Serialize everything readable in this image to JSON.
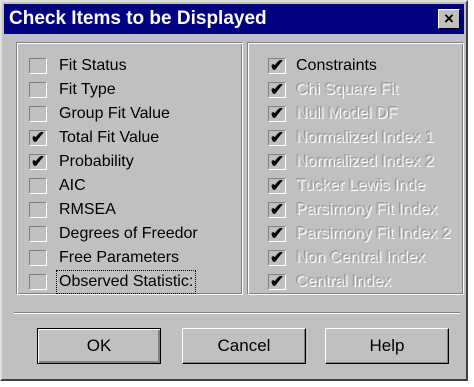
{
  "dialog": {
    "title": "Check Items to be Displayed",
    "close_label": "×"
  },
  "left_items": [
    {
      "label": "Fit Status",
      "checked": false,
      "disabled": false
    },
    {
      "label": "Fit Type",
      "checked": false,
      "disabled": false
    },
    {
      "label": "Group Fit Value",
      "checked": false,
      "disabled": false
    },
    {
      "label": "Total Fit Value",
      "checked": true,
      "disabled": false
    },
    {
      "label": "Probability",
      "checked": true,
      "disabled": false
    },
    {
      "label": "AIC",
      "checked": false,
      "disabled": false
    },
    {
      "label": "RMSEA",
      "checked": false,
      "disabled": false
    },
    {
      "label": "Degrees of Freedor",
      "checked": false,
      "disabled": false
    },
    {
      "label": "Free Parameters",
      "checked": false,
      "disabled": false
    },
    {
      "label": "Observed Statistic:",
      "checked": false,
      "disabled": false,
      "focused": true
    }
  ],
  "right_items": [
    {
      "label": "Constraints",
      "checked": true,
      "disabled": false
    },
    {
      "label": "Chi Square Fit",
      "checked": true,
      "disabled": true
    },
    {
      "label": "Null Model DF",
      "checked": true,
      "disabled": true
    },
    {
      "label": "Normalized Index 1",
      "checked": true,
      "disabled": true
    },
    {
      "label": "Normalized Index 2",
      "checked": true,
      "disabled": true
    },
    {
      "label": "Tucker Lewis Inde",
      "checked": true,
      "disabled": true
    },
    {
      "label": "Parsimony Fit Index",
      "checked": true,
      "disabled": true
    },
    {
      "label": "Parsimony Fit Index 2",
      "checked": true,
      "disabled": true
    },
    {
      "label": "Non Central Index",
      "checked": true,
      "disabled": true
    },
    {
      "label": "Central Index",
      "checked": true,
      "disabled": true
    }
  ],
  "check_mark": "✔",
  "buttons": {
    "ok": "OK",
    "cancel": "Cancel",
    "help": "Help"
  }
}
